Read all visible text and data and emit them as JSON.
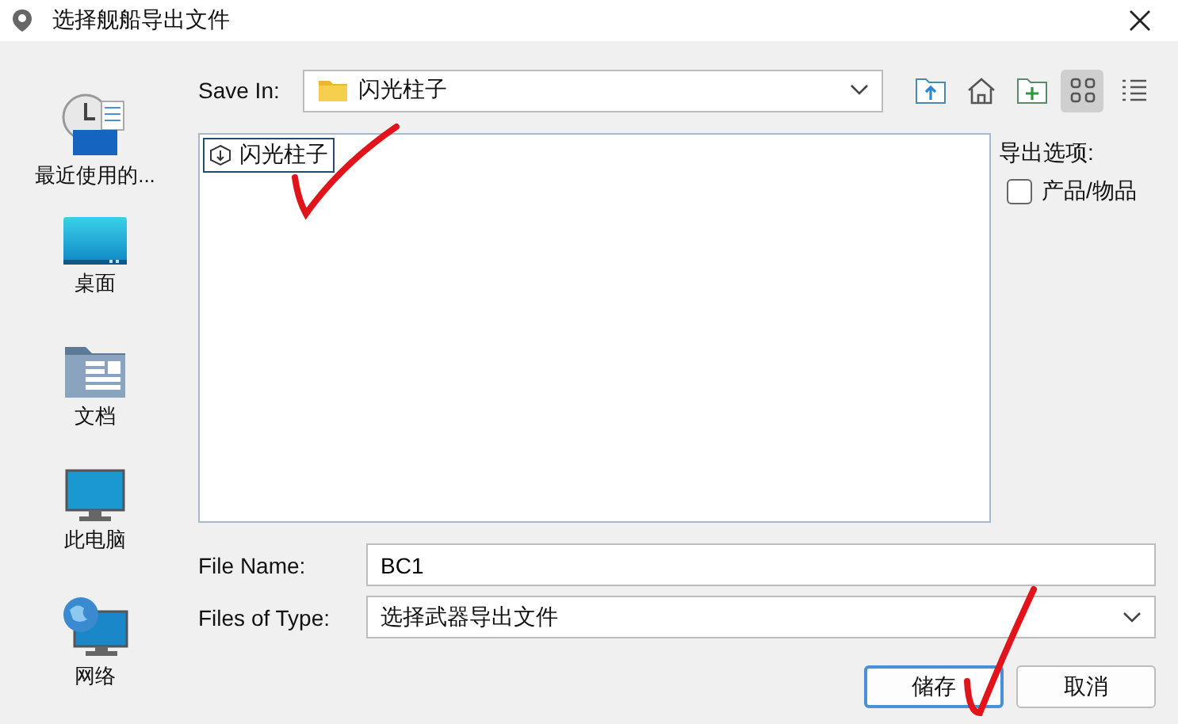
{
  "window": {
    "title": "选择舰船导出文件"
  },
  "sidebar": {
    "items": [
      {
        "kind": "recent",
        "label": "最近使用的..."
      },
      {
        "kind": "desktop",
        "label": "桌面"
      },
      {
        "kind": "documents",
        "label": "文档"
      },
      {
        "kind": "computer",
        "label": "此电脑"
      },
      {
        "kind": "network",
        "label": "网络"
      }
    ]
  },
  "save_in": {
    "label": "Save In:",
    "value": "闪光柱子"
  },
  "toolbar": [
    {
      "kind": "up",
      "selected": false
    },
    {
      "kind": "home",
      "selected": false
    },
    {
      "kind": "new-folder",
      "selected": false
    },
    {
      "kind": "grid-view",
      "selected": true
    },
    {
      "kind": "list-view",
      "selected": false
    }
  ],
  "files": [
    {
      "name": "闪光柱子",
      "selected": true
    }
  ],
  "export_options": {
    "title": "导出选项:",
    "options": [
      {
        "label": "产品/物品",
        "checked": false
      }
    ]
  },
  "file_name": {
    "label": "File Name:",
    "value": "BC1"
  },
  "file_type": {
    "label": "Files of Type:",
    "value": "选择武器导出文件"
  },
  "buttons": [
    {
      "label": "储存",
      "kind": "default"
    },
    {
      "label": "取消",
      "kind": "normal"
    }
  ]
}
